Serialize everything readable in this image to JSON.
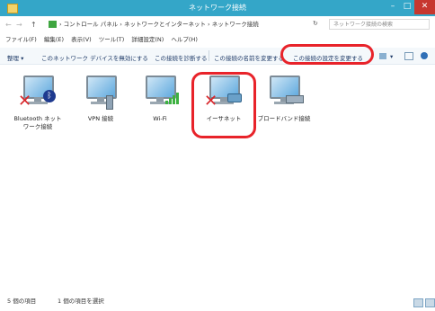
{
  "window": {
    "title": "ネットワーク接続",
    "controls": {
      "minimize": "–",
      "maximize": "□",
      "close": "✕"
    }
  },
  "address_bar": {
    "back": "←",
    "forward": "→",
    "up": "↑",
    "breadcrumb": "› コントロール パネル › ネットワークとインターネット › ネットワーク接続",
    "refresh": "↻",
    "search_placeholder": "ネットワーク接続の検索"
  },
  "menu": [
    "ファイル(F)",
    "編集(E)",
    "表示(V)",
    "ツール(T)",
    "詳細設定(N)",
    "ヘルプ(H)"
  ],
  "toolbar": {
    "organize": "整理 ▾",
    "disable": "このネットワーク デバイスを無効にする",
    "diagnose": "この接続を診断する",
    "rename": "この接続の名前を変更する",
    "change_settings": "この接続の設定を変更する",
    "view": "▾"
  },
  "devices": [
    {
      "label": "Bluetooth ネット\nワーク接続",
      "icon": "bluetooth-network-icon",
      "disabled": true
    },
    {
      "label": "VPN 接続",
      "icon": "vpn-connection-icon",
      "disabled": false
    },
    {
      "label": "Wi-Fi",
      "icon": "wifi-connection-icon",
      "disabled": false
    },
    {
      "label": "イーサネット",
      "icon": "ethernet-connection-icon",
      "disabled": true,
      "selected": true
    },
    {
      "label": "ブロードバンド接続",
      "icon": "broadband-connection-icon",
      "disabled": false
    }
  ],
  "status": {
    "count": "5 個の項目",
    "selected": "1 個の項目を選択"
  },
  "colors": {
    "titlebar": "#34a6c8",
    "highlight": "#e8232a",
    "close": "#c7372f"
  }
}
